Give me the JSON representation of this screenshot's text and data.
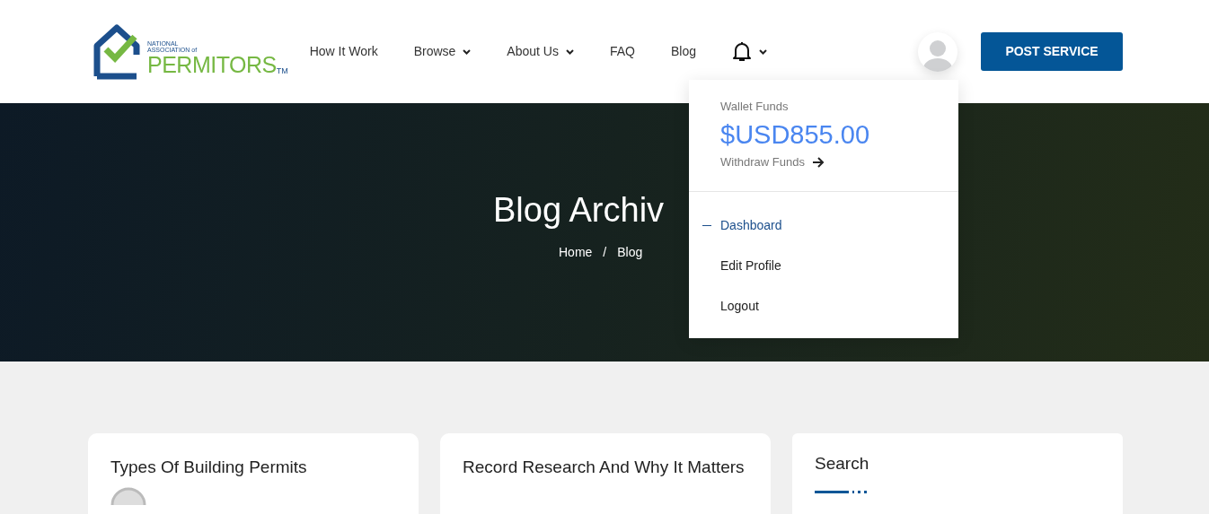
{
  "logo": {
    "line_1": "NATIONAL",
    "line_2": "ASSOCIATION of",
    "line_3": "PERMITORS",
    "mark": "TM"
  },
  "nav": [
    {
      "label": "How It Work",
      "has_caret": false
    },
    {
      "label": "Browse",
      "has_caret": true
    },
    {
      "label": "About Us",
      "has_caret": true
    },
    {
      "label": "FAQ",
      "has_caret": false
    },
    {
      "label": "Blog",
      "has_caret": false
    }
  ],
  "post_button": "POST SERVICE",
  "hero": {
    "title": "Blog Archiv",
    "breadcrumb": [
      "Home",
      "Blog"
    ],
    "separator": "/"
  },
  "account_menu": {
    "wallet_label": "Wallet Funds",
    "wallet_amount": "$USD855.00",
    "withdraw": "Withdraw Funds",
    "items": [
      {
        "label": "Dashboard",
        "selected": true
      },
      {
        "label": "Edit Profile",
        "selected": false
      },
      {
        "label": "Logout",
        "selected": false
      }
    ]
  },
  "posts": [
    {
      "title": "Types Of Building Permits"
    },
    {
      "title": "Record Research And Why It Matters"
    }
  ],
  "sidebar": {
    "title": "Search"
  }
}
